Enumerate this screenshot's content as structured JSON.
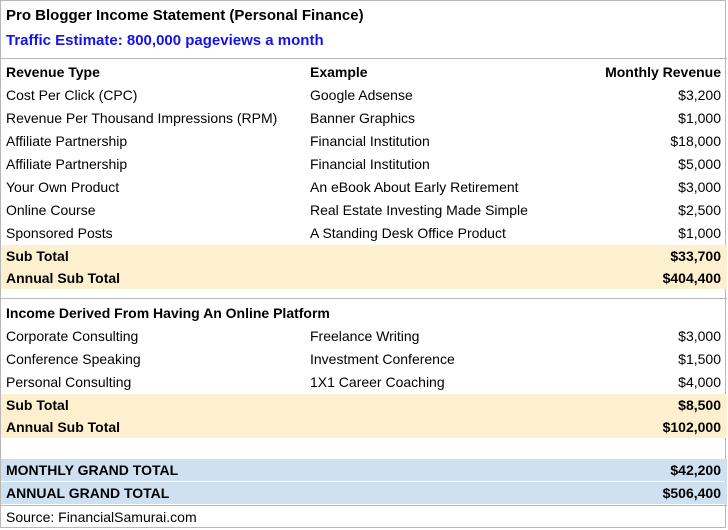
{
  "title": "Pro Blogger Income Statement (Personal Finance)",
  "subtitle": "Traffic Estimate: 800,000 pageviews a month",
  "colors": {
    "subtitle": "#1414e8",
    "subtotal_fill": "#fdf0cf",
    "grand_fill": "#cfe0f1"
  },
  "headers": {
    "col1": "Revenue Type",
    "col2": "Example",
    "col3": "Monthly Revenue"
  },
  "revenue_rows": [
    {
      "type": "Cost Per Click (CPC)",
      "example": "Google Adsense",
      "amount": "$3,200"
    },
    {
      "type": "Revenue Per Thousand Impressions (RPM)",
      "example": "Banner Graphics",
      "amount": "$1,000"
    },
    {
      "type": "Affiliate Partnership",
      "example": "Financial Institution",
      "amount": "$18,000"
    },
    {
      "type": "Affiliate Partnership",
      "example": "Financial Institution",
      "amount": "$5,000"
    },
    {
      "type": "Your Own Product",
      "example": "An eBook About Early Retirement",
      "amount": "$3,000"
    },
    {
      "type": "Online Course",
      "example": "Real Estate Investing Made Simple",
      "amount": "$2,500"
    },
    {
      "type": "Sponsored Posts",
      "example": "A Standing Desk Office Product",
      "amount": "$1,000"
    }
  ],
  "revenue_subtotal": {
    "label": "Sub Total",
    "amount": "$33,700"
  },
  "revenue_annual": {
    "label": "Annual Sub Total",
    "amount": "$404,400"
  },
  "platform_header": "Income Derived From Having An Online Platform",
  "platform_rows": [
    {
      "type": "Corporate Consulting",
      "example": "Freelance Writing",
      "amount": "$3,000"
    },
    {
      "type": "Conference Speaking",
      "example": "Investment Conference",
      "amount": "$1,500"
    },
    {
      "type": "Personal Consulting",
      "example": "1X1 Career Coaching",
      "amount": "$4,000"
    }
  ],
  "platform_subtotal": {
    "label": "Sub Total",
    "amount": "$8,500"
  },
  "platform_annual": {
    "label": "Annual Sub Total",
    "amount": "$102,000"
  },
  "monthly_grand": {
    "label": "MONTHLY GRAND TOTAL",
    "amount": "$42,200"
  },
  "annual_grand": {
    "label": "ANNUAL GRAND TOTAL",
    "amount": "$506,400"
  },
  "source": "Source: FinancialSamurai.com"
}
